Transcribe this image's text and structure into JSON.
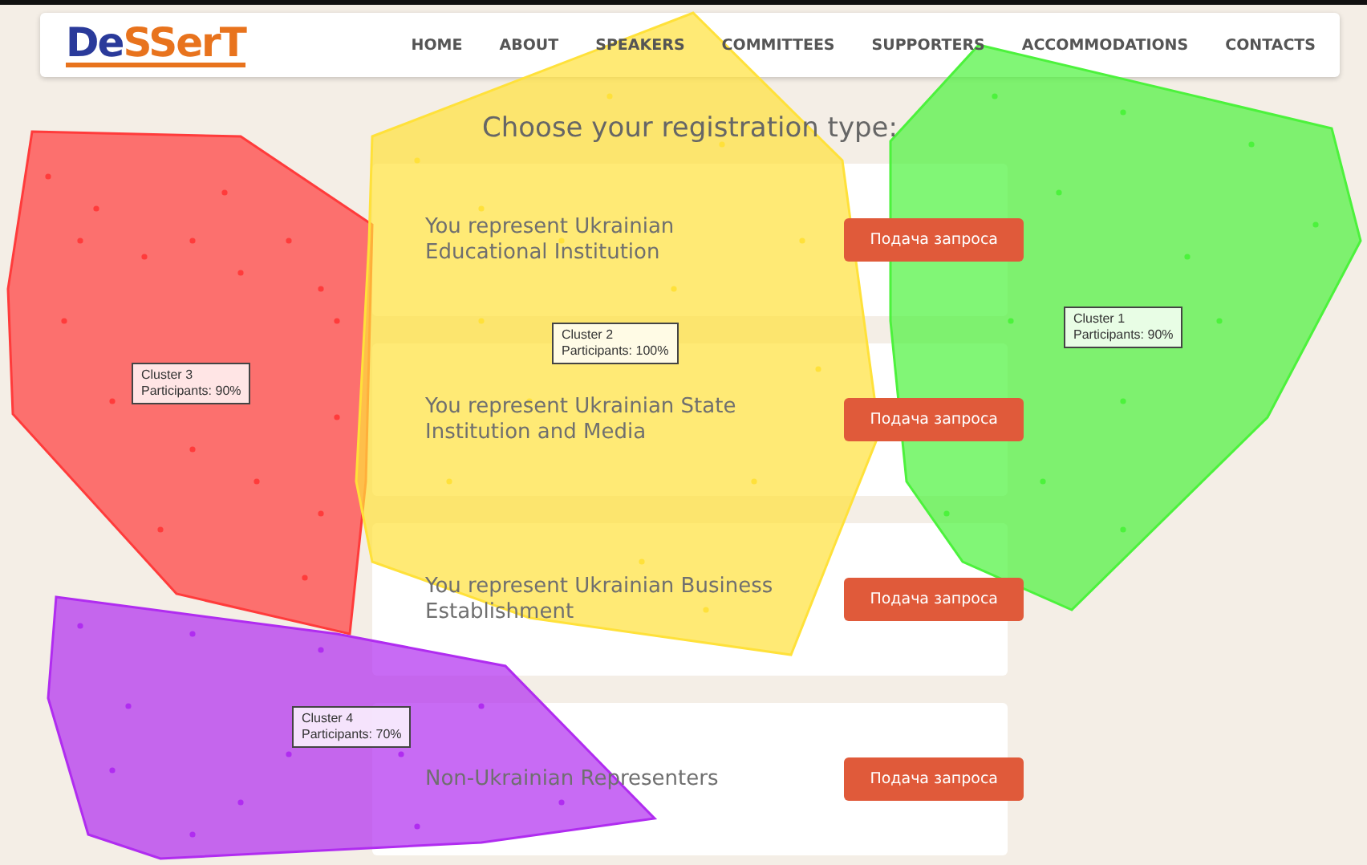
{
  "header": {
    "logo": [
      "De",
      "SSerT"
    ],
    "nav": [
      "HOME",
      "ABOUT",
      "SPEAKERS",
      "COMMITTEES",
      "SUPPORTERS",
      "ACCOMMODATIONS",
      "CONTACTS"
    ]
  },
  "title": "Choose your registration type:",
  "options": [
    {
      "label": "You represent Ukrainian Educational Institution",
      "button": "Подача запроса"
    },
    {
      "label": "You represent Ukrainian State Institution and Media",
      "button": "Подача запроса"
    },
    {
      "label": "You represent Ukrainian Business Establishment",
      "button": "Подача запроса"
    },
    {
      "label": "Non-Ukrainian Representers",
      "button": "Подача запроса"
    }
  ],
  "clusters": [
    {
      "name": "Cluster 3",
      "participants": "Participants: 90%",
      "color": "#ff3b3b"
    },
    {
      "name": "Cluster 2",
      "participants": "Participants: 100%",
      "color": "#ffe13a"
    },
    {
      "name": "Cluster 1",
      "participants": "Participants: 90%",
      "color": "#4cf23c"
    },
    {
      "name": "Cluster 4",
      "participants": "Participants: 70%",
      "color": "#b02cf0"
    }
  ]
}
